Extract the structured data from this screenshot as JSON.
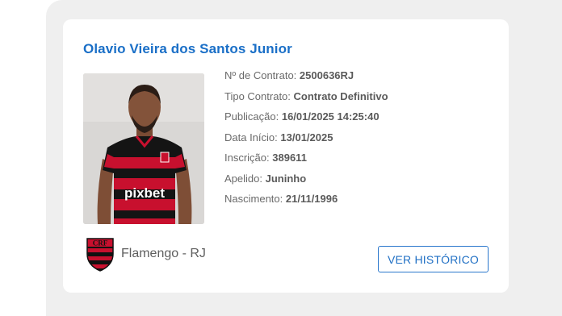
{
  "player": {
    "name": "Olavio Vieira dos Santos Junior",
    "photo_icon": "player-photo",
    "jersey_sponsor": "pixbet"
  },
  "details": [
    {
      "label": "Nº de Contrato:",
      "value": "2500636RJ"
    },
    {
      "label": "Tipo Contrato:",
      "value": "Contrato Definitivo"
    },
    {
      "label": "Publicação:",
      "value": "16/01/2025 14:25:40"
    },
    {
      "label": "Data Início:",
      "value": "13/01/2025"
    },
    {
      "label": "Inscrição:",
      "value": "389611"
    },
    {
      "label": "Apelido:",
      "value": "Juninho"
    },
    {
      "label": "Nascimento:",
      "value": "21/11/1996"
    }
  ],
  "club": {
    "name": "Flamengo - RJ",
    "crest_icon": "flamengo-crest-icon"
  },
  "actions": {
    "history_label": "VER HISTÓRICO"
  },
  "colors": {
    "accent": "#1a6fc7",
    "club_red": "#c8102e",
    "club_black": "#111111"
  }
}
